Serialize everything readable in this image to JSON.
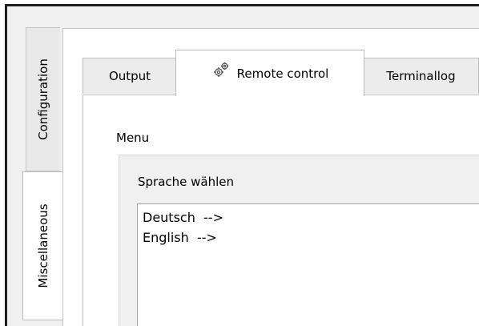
{
  "side_tabs": [
    {
      "label": "Configuration"
    },
    {
      "label": "Miscellaneous"
    }
  ],
  "tabs": [
    {
      "label": "Output"
    },
    {
      "label": "Remote control",
      "icon": "gears-icon"
    },
    {
      "label": "Terminallog"
    }
  ],
  "menu": {
    "label": "Menu",
    "group_title": "Sprache wählen",
    "items": [
      "Deutsch  -->",
      "English  -->"
    ]
  }
}
